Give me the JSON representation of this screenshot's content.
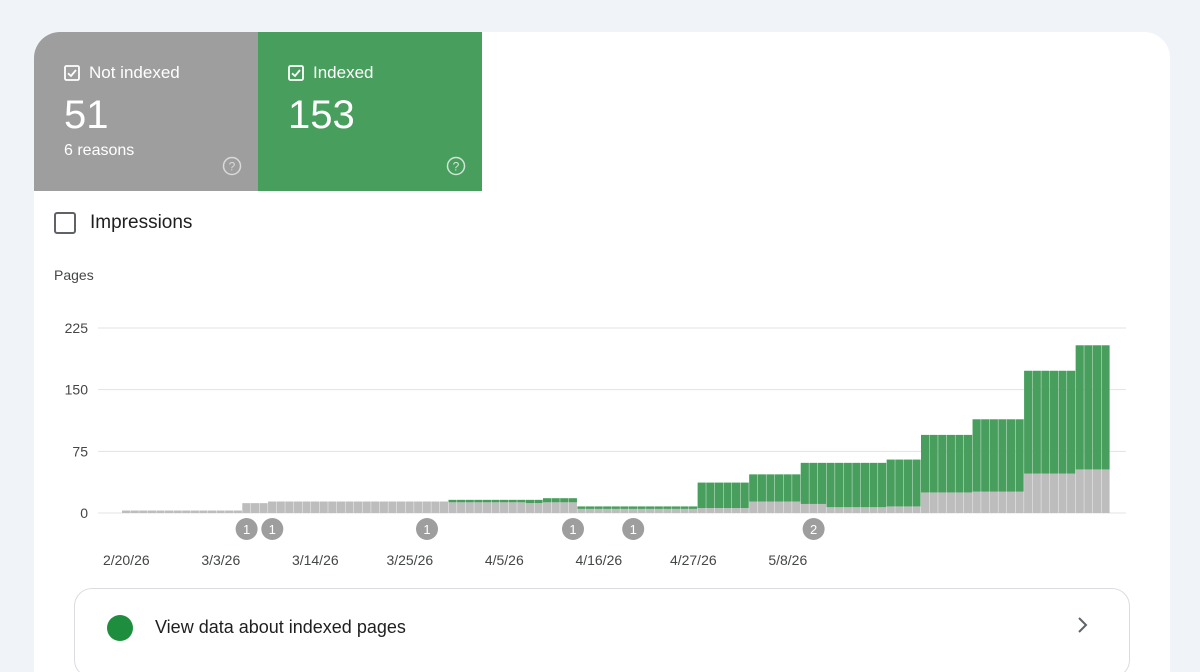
{
  "tiles": {
    "not_indexed": {
      "label": "Not indexed",
      "count": "51",
      "sub": "6 reasons",
      "color": "#9e9e9e"
    },
    "indexed": {
      "label": "Indexed",
      "count": "153",
      "color": "#489e5d"
    }
  },
  "impressions": {
    "label": "Impressions",
    "checked": false
  },
  "link": {
    "text": "View data about indexed pages"
  },
  "chart_data": {
    "type": "bar",
    "stacked": true,
    "ylabel": "Pages",
    "ylim": [
      0,
      225
    ],
    "yticks": [
      "0",
      "75",
      "150",
      "225"
    ],
    "xlabels": [
      "2/20/26",
      "3/3/26",
      "3/14/26",
      "3/25/26",
      "4/5/26",
      "4/16/26",
      "4/27/26",
      "5/8/26"
    ],
    "grid": true,
    "series": [
      {
        "color": "#bdbdbd",
        "values": [
          3,
          3,
          3,
          3,
          3,
          3,
          3,
          3,
          3,
          3,
          3,
          3,
          3,
          3,
          12,
          12,
          12,
          14,
          14,
          14,
          14,
          14,
          14,
          14,
          14,
          14,
          14,
          14,
          14,
          14,
          14,
          14,
          14,
          14,
          14,
          14,
          14,
          14,
          13,
          13,
          13,
          13,
          13,
          13,
          13,
          13,
          13,
          12,
          12,
          13,
          13,
          13,
          13,
          5,
          5,
          5,
          5,
          5,
          5,
          5,
          5,
          5,
          5,
          5,
          5,
          5,
          5,
          6,
          6,
          6,
          6,
          6,
          6,
          14,
          14,
          14,
          14,
          14,
          14,
          11,
          11,
          11,
          7,
          7,
          7,
          7,
          7,
          7,
          7,
          8,
          8,
          8,
          8,
          25,
          25,
          25,
          25,
          25,
          25,
          26,
          26,
          26,
          26,
          26,
          26,
          48,
          48,
          48,
          48,
          48,
          48,
          53,
          53,
          53,
          53
        ]
      },
      {
        "color": "#489e5d",
        "values": [
          0,
          0,
          0,
          0,
          0,
          0,
          0,
          0,
          0,
          0,
          0,
          0,
          0,
          0,
          0,
          0,
          0,
          0,
          0,
          0,
          0,
          0,
          0,
          0,
          0,
          0,
          0,
          0,
          0,
          0,
          0,
          0,
          0,
          0,
          0,
          0,
          0,
          0,
          3,
          3,
          3,
          3,
          3,
          3,
          3,
          3,
          3,
          4,
          4,
          5,
          5,
          5,
          5,
          3,
          3,
          3,
          3,
          3,
          3,
          3,
          3,
          3,
          3,
          3,
          3,
          3,
          3,
          31,
          31,
          31,
          31,
          31,
          31,
          33,
          33,
          33,
          33,
          33,
          33,
          50,
          50,
          50,
          54,
          54,
          54,
          54,
          54,
          54,
          54,
          57,
          57,
          57,
          57,
          70,
          70,
          70,
          70,
          70,
          70,
          88,
          88,
          88,
          88,
          88,
          88,
          125,
          125,
          125,
          125,
          125,
          125,
          151,
          151,
          151,
          151
        ]
      }
    ],
    "annotations": [
      {
        "day": 14,
        "label": "1"
      },
      {
        "day": 17,
        "label": "1"
      },
      {
        "day": 35,
        "label": "1"
      },
      {
        "day": 52,
        "label": "1"
      },
      {
        "day": 59,
        "label": "1"
      },
      {
        "day": 80,
        "label": "2"
      }
    ],
    "annotation_color": "#9e9e9e"
  }
}
